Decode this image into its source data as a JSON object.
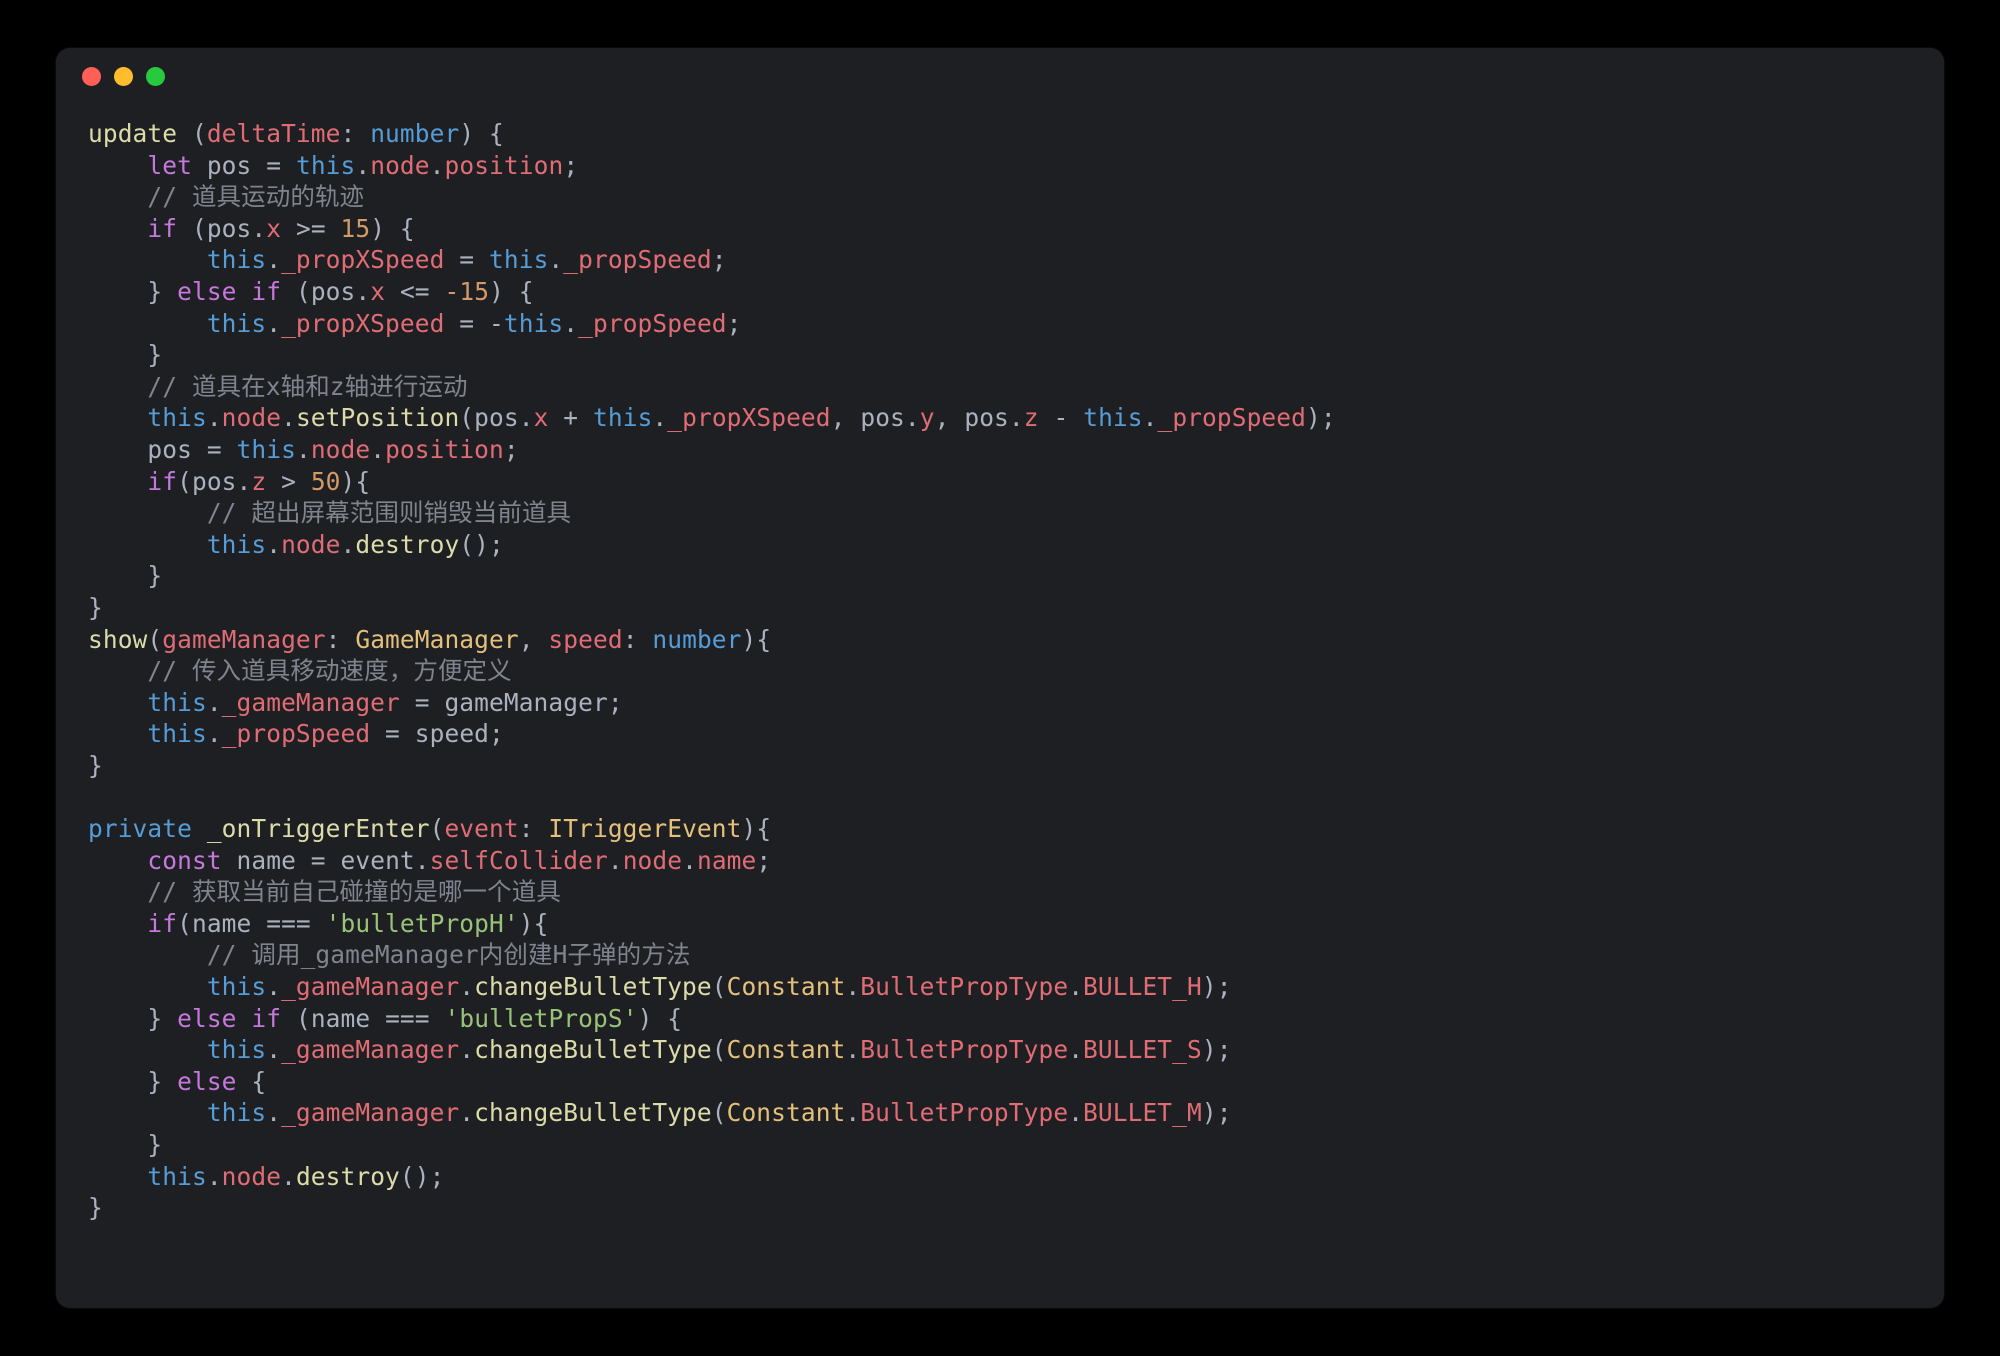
{
  "code": {
    "l1": {
      "fn": "update",
      "a": "deltaTime",
      "t": "number"
    },
    "l2": {
      "kw": "let",
      "v": "pos",
      "th": "this",
      "p1": "node",
      "p2": "position"
    },
    "l3": {
      "c": "// 道具运动的轨迹"
    },
    "l4": {
      "kw": "if",
      "v": "pos",
      "p": "x",
      "n": "15"
    },
    "l5": {
      "th": "this",
      "p1": "_propXSpeed",
      "th2": "this",
      "p2": "_propSpeed"
    },
    "l6": {
      "kw": "else if",
      "v": "pos",
      "p": "x",
      "n": "-15"
    },
    "l7": {
      "th": "this",
      "p1": "_propXSpeed",
      "th2": "this",
      "p2": "_propSpeed"
    },
    "l8": {
      "c": "// 道具在x轴和z轴进行运动"
    },
    "l9": {
      "th": "this",
      "p1": "node",
      "fn": "setPosition",
      "v": "pos",
      "px": "x",
      "th2": "this",
      "p2": "_propXSpeed",
      "py": "y",
      "pz": "z",
      "th3": "this",
      "p3": "_propSpeed"
    },
    "l10": {
      "v": "pos",
      "th": "this",
      "p1": "node",
      "p2": "position"
    },
    "l11": {
      "kw": "if",
      "v": "pos",
      "p": "z",
      "n": "50"
    },
    "l12": {
      "c": "// 超出屏幕范围则销毁当前道具"
    },
    "l13": {
      "th": "this",
      "p1": "node",
      "fn": "destroy"
    },
    "l14": {
      "fn": "show",
      "a1": "gameManager",
      "t1": "GameManager",
      "a2": "speed",
      "t2": "number"
    },
    "l15": {
      "c": "// 传入道具移动速度，方便定义"
    },
    "l16": {
      "th": "this",
      "p1": "_gameManager",
      "v": "gameManager"
    },
    "l17": {
      "th": "this",
      "p1": "_propSpeed",
      "v": "speed"
    },
    "l18": {
      "kw": "private",
      "fn": "_onTriggerEnter",
      "a": "event",
      "t": "ITriggerEvent"
    },
    "l19": {
      "kw": "const",
      "v": "name",
      "a": "event",
      "p1": "selfCollider",
      "p2": "node",
      "p3": "name"
    },
    "l20": {
      "c": "// 获取当前自己碰撞的是哪一个道具"
    },
    "l21": {
      "kw": "if",
      "v": "name",
      "s": "'bulletPropH'"
    },
    "l22": {
      "c": "// 调用_gameManager内创建H子弹的方法"
    },
    "l23": {
      "th": "this",
      "p1": "_gameManager",
      "fn": "changeBulletType",
      "t": "Constant",
      "p2": "BulletPropType",
      "p3": "BULLET_H"
    },
    "l24": {
      "kw": "else if",
      "v": "name",
      "s": "'bulletPropS'"
    },
    "l25": {
      "th": "this",
      "p1": "_gameManager",
      "fn": "changeBulletType",
      "t": "Constant",
      "p2": "BulletPropType",
      "p3": "BULLET_S"
    },
    "l26": {
      "kw": "else"
    },
    "l27": {
      "th": "this",
      "p1": "_gameManager",
      "fn": "changeBulletType",
      "t": "Constant",
      "p2": "BulletPropType",
      "p3": "BULLET_M"
    },
    "l28": {
      "th": "this",
      "p1": "node",
      "fn": "destroy"
    }
  }
}
